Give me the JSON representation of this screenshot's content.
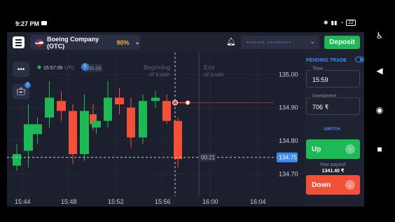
{
  "status_bar": {
    "time": "9:27 PM",
    "battery": "22"
  },
  "header": {
    "asset_name": "Boeing Company (OTC)",
    "payout_percent": "90%",
    "account_masked": "••••••• •••••••••",
    "deposit_label": "Deposit"
  },
  "chart": {
    "server_time": "15:57:39",
    "timezone": "UTC",
    "info_badge": "1",
    "price_tag_partial": "35.06",
    "beginning_label_1": "Beginning",
    "beginning_label_2": "of trade",
    "end_label_1": "End",
    "end_label_2": "of trade",
    "countdown": "00:21",
    "portfolio_badge": "1"
  },
  "chart_data": {
    "type": "candlestick",
    "x_ticks": [
      "15:44",
      "15:48",
      "15:52",
      "15:56",
      "16:00",
      "16:04"
    ],
    "y_ticks": [
      135.0,
      134.9,
      134.8,
      134.7
    ],
    "y_tick_labels": [
      "135.00",
      "134.90",
      "134.80",
      "134.70"
    ],
    "ylim": [
      134.665,
      135.045
    ],
    "current_price": 134.75,
    "current_price_label": "134.75",
    "open_trade_price": 134.915,
    "candles": [
      {
        "time": "15:43",
        "open": 134.725,
        "close": 134.76,
        "high": 134.79,
        "low": 134.71
      },
      {
        "time": "15:44",
        "open": 134.77,
        "close": 134.85,
        "high": 134.91,
        "low": 134.72
      },
      {
        "time": "15:45",
        "open": 134.82,
        "close": 134.85,
        "high": 134.87,
        "low": 134.79
      },
      {
        "time": "15:46",
        "open": 134.87,
        "close": 134.93,
        "high": 134.98,
        "low": 134.84
      },
      {
        "time": "15:47",
        "open": 134.92,
        "close": 134.89,
        "high": 134.95,
        "low": 134.86
      },
      {
        "time": "15:48",
        "open": 134.89,
        "close": 134.76,
        "high": 134.91,
        "low": 134.73
      },
      {
        "time": "15:49",
        "open": 134.76,
        "close": 134.89,
        "high": 134.94,
        "low": 134.74
      },
      {
        "time": "15:50",
        "open": 134.88,
        "close": 134.85,
        "high": 134.91,
        "low": 134.83
      },
      {
        "time": "15:51",
        "open": 134.84,
        "close": 134.86,
        "high": 134.88,
        "low": 134.82
      },
      {
        "time": "15:52",
        "open": 134.86,
        "close": 134.93,
        "high": 134.98,
        "low": 134.84
      },
      {
        "time": "15:53",
        "open": 134.93,
        "close": 134.91,
        "high": 134.96,
        "low": 134.88
      },
      {
        "time": "15:54",
        "open": 134.9,
        "close": 134.81,
        "high": 134.93,
        "low": 134.78
      },
      {
        "time": "15:55",
        "open": 134.81,
        "close": 134.92,
        "high": 134.94,
        "low": 134.79
      },
      {
        "time": "15:55.5",
        "open": 134.92,
        "close": 134.93,
        "high": 134.95,
        "low": 134.9
      },
      {
        "time": "15:56",
        "open": 134.92,
        "close": 134.86,
        "high": 134.94,
        "low": 134.85
      },
      {
        "time": "15:57",
        "open": 134.86,
        "close": 134.745,
        "high": 134.87,
        "low": 134.72
      }
    ]
  },
  "panel": {
    "pending_label": "PENDING TRADE",
    "time_label": "Time",
    "time_value": "15:59",
    "investment_label": "Investment",
    "investment_value": "706 ₹",
    "switch_label": "SWITCH",
    "up_label": "Up",
    "payout_label": "Your payout:",
    "payout_value": "1341.40 ₹",
    "down_label": "Down"
  },
  "colors": {
    "up": "#1db954",
    "down": "#f25039",
    "accent": "#3d8bf2",
    "background": "#1c1f2d"
  }
}
